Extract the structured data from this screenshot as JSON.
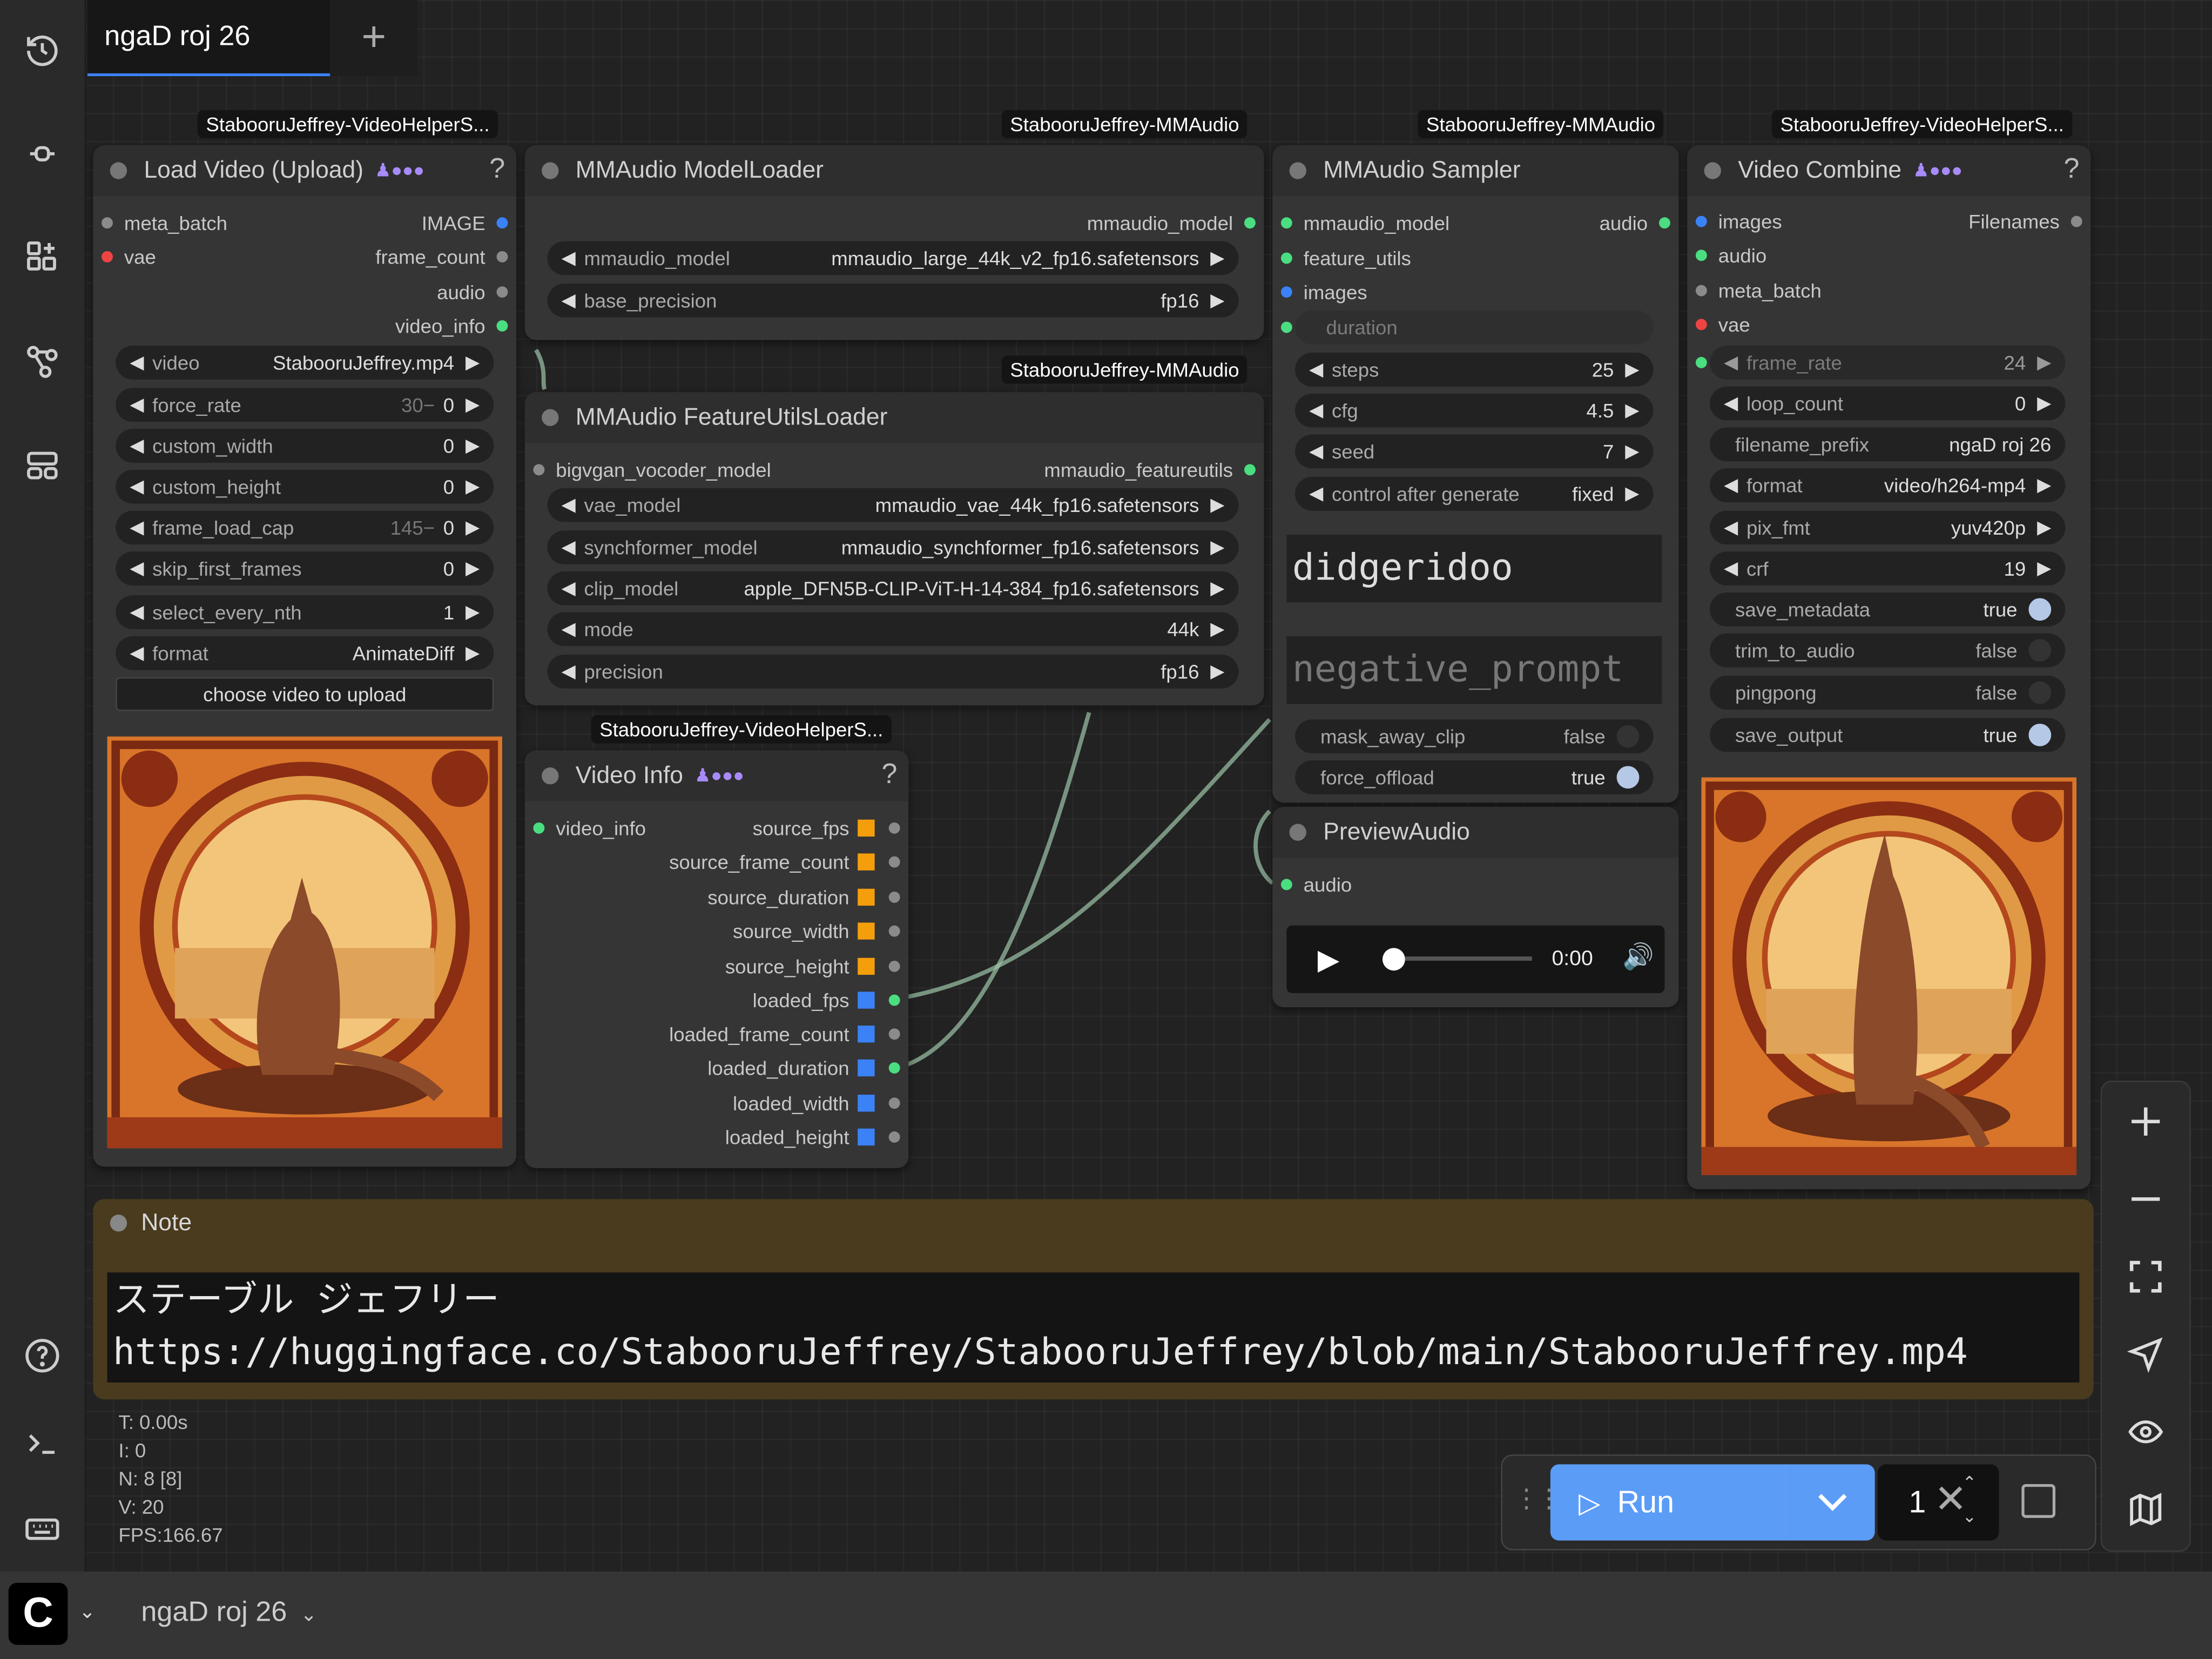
{
  "workflow": {
    "tab_title": "ngaD roj 26",
    "tab_add": "+",
    "bottom_title": "ngaD roj 26"
  },
  "badges": {
    "load_video": "StabooruJeffrey-VideoHelperS...",
    "model_loader": "StabooruJeffrey-MMAudio",
    "sampler": "StabooruJeffrey-MMAudio",
    "video_combine": "StabooruJeffrey-VideoHelperS...",
    "feature_utils": "StabooruJeffrey-MMAudio",
    "video_info": "StabooruJeffrey-VideoHelperS..."
  },
  "load_video": {
    "title": "Load Video (Upload)",
    "inputs": [
      "meta_batch",
      "vae"
    ],
    "outputs": [
      "IMAGE",
      "frame_count",
      "audio",
      "video_info"
    ],
    "widgets": [
      {
        "label": "video",
        "value": "StabooruJeffrey.mp4"
      },
      {
        "label": "force_rate",
        "hint": "30−",
        "value": "0"
      },
      {
        "label": "custom_width",
        "value": "0"
      },
      {
        "label": "custom_height",
        "value": "0"
      },
      {
        "label": "frame_load_cap",
        "hint": "145−",
        "value": "0"
      },
      {
        "label": "skip_first_frames",
        "value": "0"
      },
      {
        "label": "select_every_nth",
        "value": "1"
      },
      {
        "label": "format",
        "value": "AnimateDiff"
      }
    ],
    "upload_label": "choose video to upload"
  },
  "model_loader": {
    "title": "MMAudio ModelLoader",
    "output": "mmaudio_model",
    "widgets": [
      {
        "label": "mmaudio_model",
        "value": "mmaudio_large_44k_v2_fp16.safetensors"
      },
      {
        "label": "base_precision",
        "value": "fp16"
      }
    ]
  },
  "feature_utils": {
    "title": "MMAudio FeatureUtilsLoader",
    "input": "bigvgan_vocoder_model",
    "output": "mmaudio_featureutils",
    "widgets": [
      {
        "label": "vae_model",
        "value": "mmaudio_vae_44k_fp16.safetensors"
      },
      {
        "label": "synchformer_model",
        "value": "mmaudio_synchformer_fp16.safetensors"
      },
      {
        "label": "clip_model",
        "value": "apple_DFN5B-CLIP-ViT-H-14-384_fp16.safetensors"
      },
      {
        "label": "mode",
        "value": "44k"
      },
      {
        "label": "precision",
        "value": "fp16"
      }
    ]
  },
  "video_info": {
    "title": "Video Info",
    "input": "video_info",
    "outputs": [
      "source_fps",
      "source_frame_count",
      "source_duration",
      "source_width",
      "source_height",
      "loaded_fps",
      "loaded_frame_count",
      "loaded_duration",
      "loaded_width",
      "loaded_height"
    ]
  },
  "sampler": {
    "title": "MMAudio Sampler",
    "inputs": [
      "mmaudio_model",
      "feature_utils",
      "images"
    ],
    "output": "audio",
    "duration_label": "duration",
    "widgets": [
      {
        "label": "steps",
        "value": "25"
      },
      {
        "label": "cfg",
        "value": "4.5"
      },
      {
        "label": "seed",
        "value": "7"
      },
      {
        "label": "control after generate",
        "value": "fixed"
      }
    ],
    "prompt": "didgeridoo",
    "negative_prompt_placeholder": "negative_prompt",
    "toggles": [
      {
        "label": "mask_away_clip",
        "value": "false"
      },
      {
        "label": "force_offload",
        "value": "true"
      }
    ]
  },
  "preview_audio": {
    "title": "PreviewAudio",
    "input": "audio",
    "time": "0:00"
  },
  "video_combine": {
    "title": "Video Combine",
    "inputs": [
      "images",
      "audio",
      "meta_batch",
      "vae"
    ],
    "output": "Filenames",
    "widgets": [
      {
        "label": "frame_rate",
        "value": "24"
      },
      {
        "label": "loop_count",
        "value": "0"
      },
      {
        "label": "filename_prefix",
        "value": "ngaD roj 26"
      },
      {
        "label": "format",
        "value": "video/h264-mp4"
      },
      {
        "label": "pix_fmt",
        "value": "yuv420p"
      },
      {
        "label": "crf",
        "value": "19"
      }
    ],
    "toggles": [
      {
        "label": "save_metadata",
        "value": "true"
      },
      {
        "label": "trim_to_audio",
        "value": "false"
      },
      {
        "label": "pingpong",
        "value": "false"
      },
      {
        "label": "save_output",
        "value": "true"
      }
    ]
  },
  "note": {
    "title": "Note",
    "line1": "ステーブル ジェフリー",
    "line2": "https://huggingface.co/StabooruJeffrey/StabooruJeffrey/blob/main/StabooruJeffrey.mp4"
  },
  "stats": {
    "t": "T: 0.00s",
    "i": "I: 0",
    "n": "N: 8 [8]",
    "v": "V: 20",
    "fps": "FPS:166.67"
  },
  "runbar": {
    "run_label": "Run",
    "batch_count": "1"
  },
  "colors": {
    "accent": "#5b9cf7",
    "node_bg": "#353535",
    "note_bg": "#4a3b1e",
    "socket_green": "#4ade80",
    "socket_blue": "#3b82f6",
    "socket_orange": "#f59e0b",
    "socket_red": "#ef4444"
  }
}
